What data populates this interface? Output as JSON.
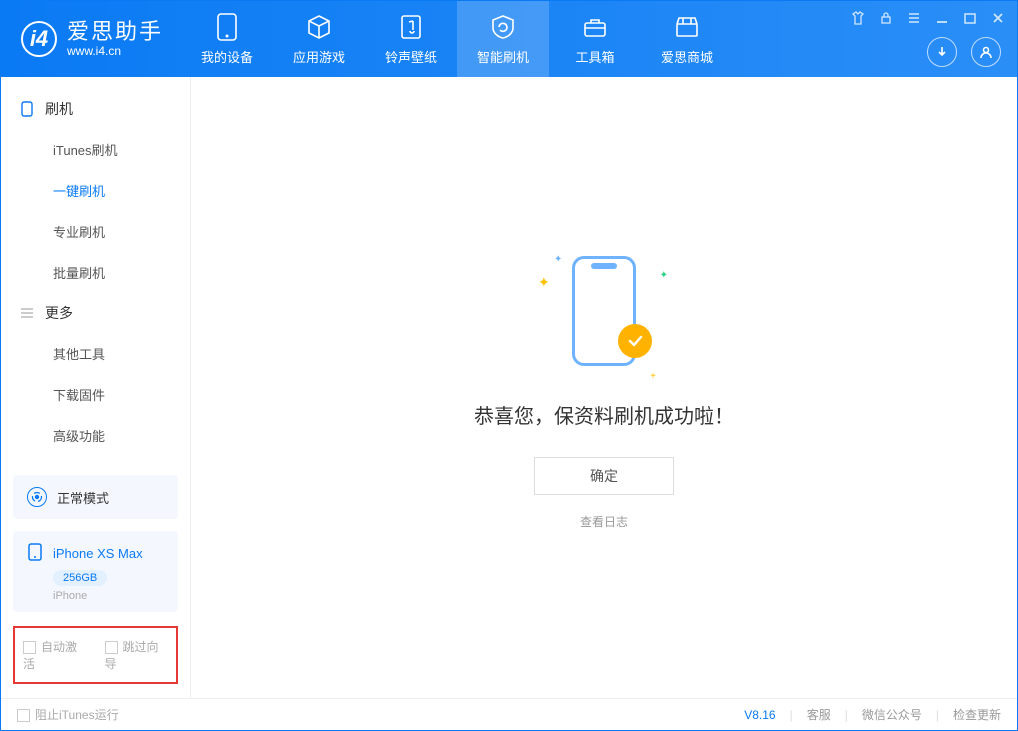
{
  "app": {
    "name": "爱思助手",
    "url": "www.i4.cn"
  },
  "nav": {
    "tabs": [
      {
        "label": "我的设备"
      },
      {
        "label": "应用游戏"
      },
      {
        "label": "铃声壁纸"
      },
      {
        "label": "智能刷机"
      },
      {
        "label": "工具箱"
      },
      {
        "label": "爱思商城"
      }
    ],
    "active_index": 3
  },
  "sidebar": {
    "sections": [
      {
        "title": "刷机",
        "items": [
          "iTunes刷机",
          "一键刷机",
          "专业刷机",
          "批量刷机"
        ],
        "active_index": 1
      },
      {
        "title": "更多",
        "items": [
          "其他工具",
          "下载固件",
          "高级功能"
        ],
        "active_index": -1
      }
    ],
    "mode_card": {
      "label": "正常模式"
    },
    "device": {
      "name": "iPhone XS Max",
      "storage": "256GB",
      "type": "iPhone"
    },
    "options": {
      "auto_activate": "自动激活",
      "skip_guide": "跳过向导"
    }
  },
  "main": {
    "success_message": "恭喜您，保资料刷机成功啦！",
    "confirm_label": "确定",
    "view_log_label": "查看日志"
  },
  "footer": {
    "block_itunes": "阻止iTunes运行",
    "version": "V8.16",
    "links": [
      "客服",
      "微信公众号",
      "检查更新"
    ]
  }
}
